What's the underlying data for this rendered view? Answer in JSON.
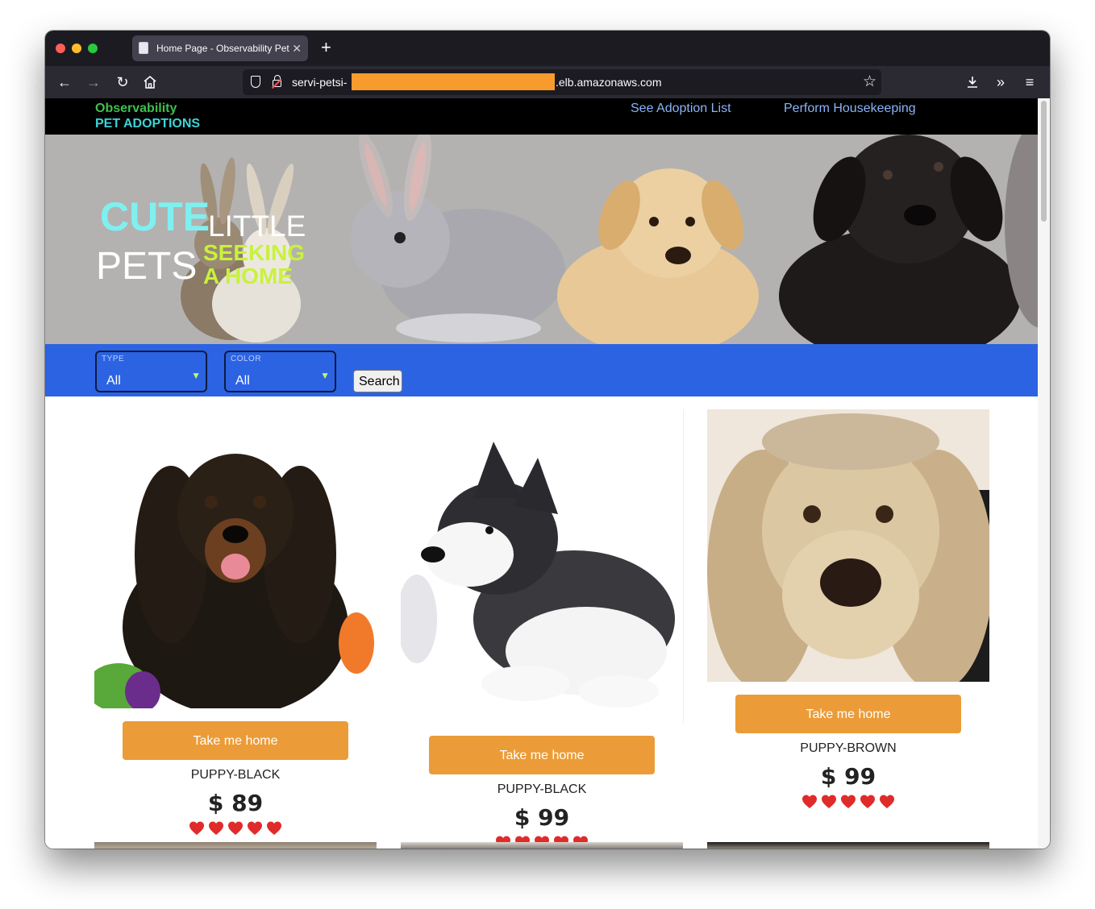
{
  "browser": {
    "tab_title": "Home Page - Observability PetA",
    "url_host_prefix": "servi-petsi-",
    "url_host_suffix": ".elb.amazonaws.com"
  },
  "site": {
    "brand_line1": "Observability",
    "brand_line2": "PET ADOPTIONS",
    "nav": [
      "See Adoption List",
      "Perform Housekeeping"
    ]
  },
  "hero": {
    "word_cute": "CUTE",
    "word_little": "LITTLE",
    "word_pets": "PETS",
    "word_seeking": "SEEKING",
    "word_a_home": "A HOME"
  },
  "filters": {
    "type_label": "TYPE",
    "type_value": "All",
    "color_label": "COLOR",
    "color_value": "All",
    "search_label": "Search"
  },
  "pets": [
    {
      "button": "Take me home",
      "name": "PUPPY-BLACK",
      "price": "$ 89",
      "hearts": 5
    },
    {
      "button": "Take me home",
      "name": "PUPPY-BLACK",
      "price": "$ 99",
      "hearts": 5
    },
    {
      "button": "Take me home",
      "name": "PUPPY-BROWN",
      "price": "$ 99",
      "hearts": 5
    }
  ],
  "colors": {
    "filter_bar": "#2b63e3",
    "button_orange": "#eb9c38",
    "brand_green": "#3fbf4f",
    "brand_cyan": "#3ed4d6",
    "nav_link": "#8ab4f8",
    "heart_red": "#e02b2b"
  }
}
